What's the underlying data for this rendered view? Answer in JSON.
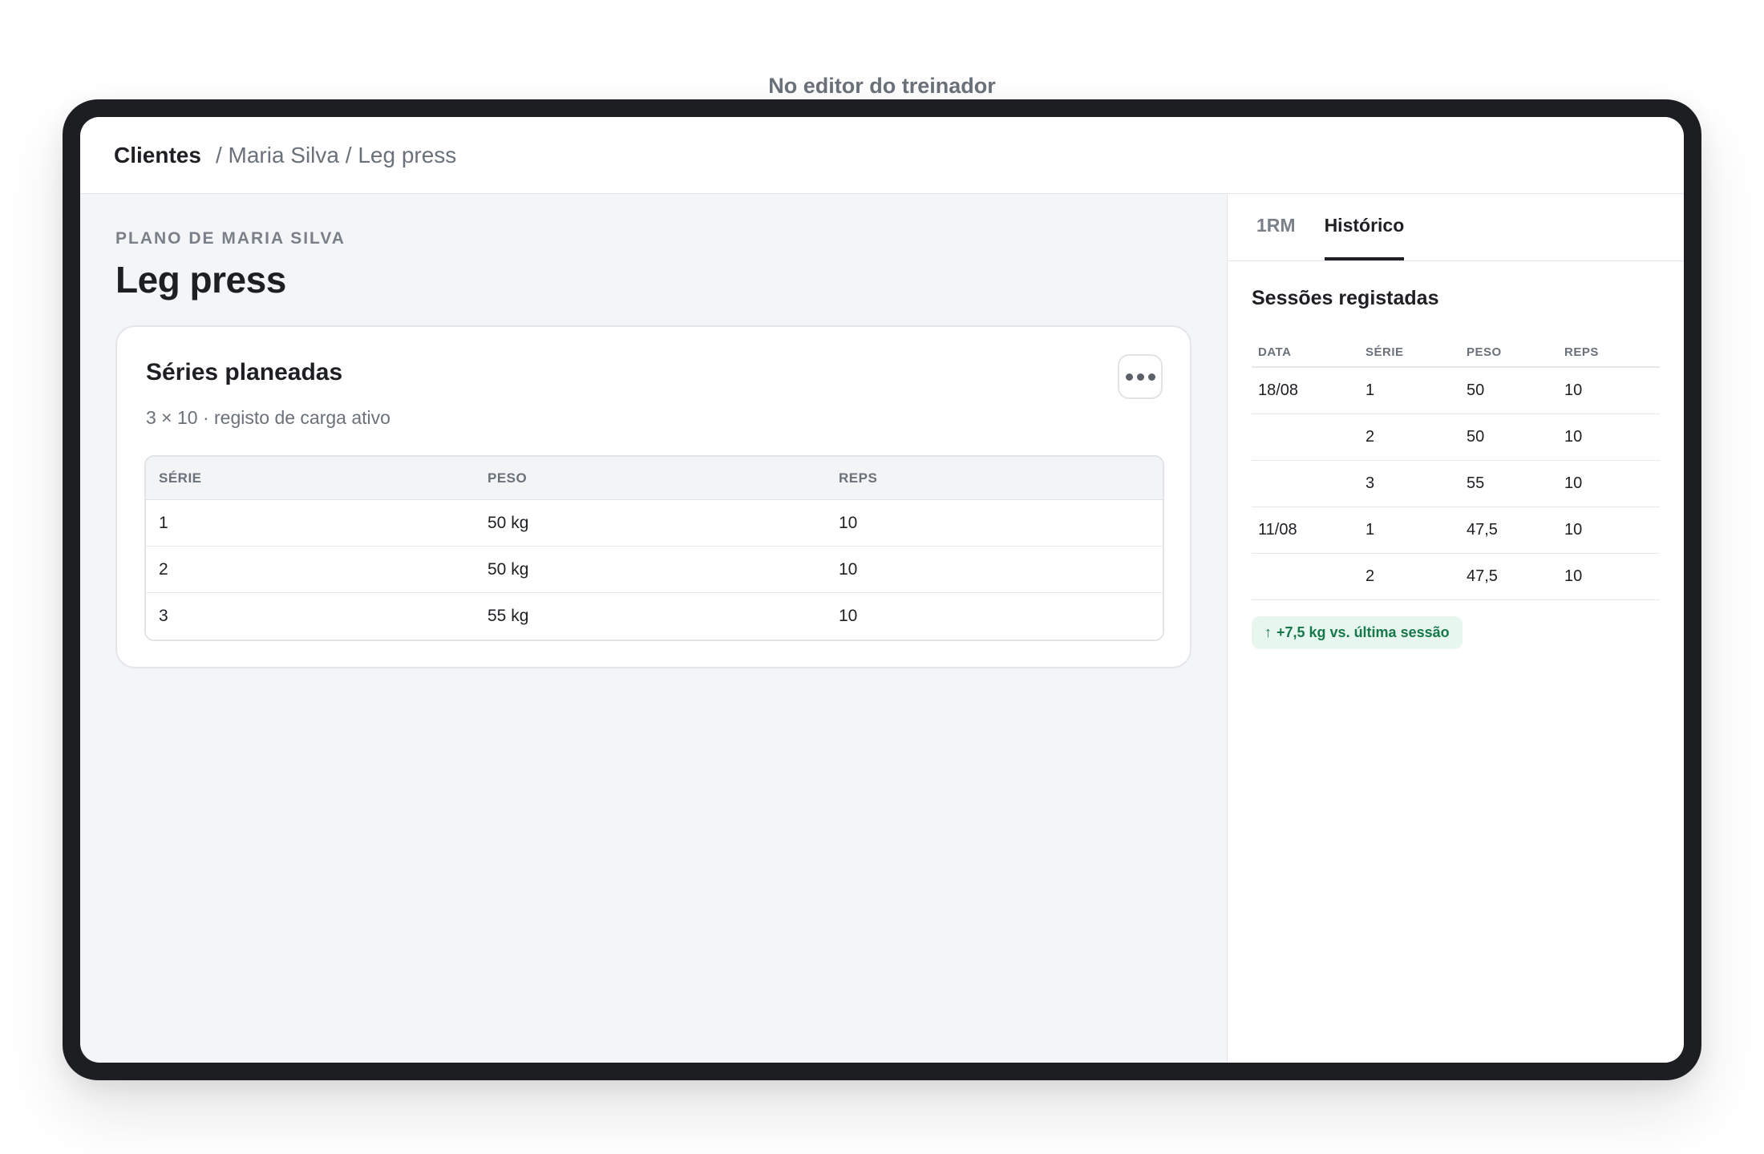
{
  "caption": "No editor do treinador",
  "breadcrumb": {
    "root": "Clientes",
    "rest": "/ Maria Silva / Leg press"
  },
  "main": {
    "overline": "PLANO DE MARIA SILVA",
    "title": "Leg press",
    "card": {
      "title": "Séries planeadas",
      "subtitle": "3 × 10 · registo de carga ativo",
      "more_icon": "more-horizontal-icon",
      "columns": [
        "SÉRIE",
        "PESO",
        "REPS"
      ],
      "rows": [
        {
          "serie": "1",
          "peso": "50 kg",
          "reps": "10"
        },
        {
          "serie": "2",
          "peso": "50 kg",
          "reps": "10"
        },
        {
          "serie": "3",
          "peso": "55 kg",
          "reps": "10"
        }
      ]
    }
  },
  "side": {
    "tabs": [
      {
        "label": "1RM",
        "active": false
      },
      {
        "label": "Histórico",
        "active": true
      }
    ],
    "title": "Sessões registadas",
    "columns": [
      "DATA",
      "SÉRIE",
      "PESO",
      "REPS"
    ],
    "rows": [
      {
        "data": "18/08",
        "serie": "1",
        "peso": "50",
        "reps": "10"
      },
      {
        "data": "",
        "serie": "2",
        "peso": "50",
        "reps": "10"
      },
      {
        "data": "",
        "serie": "3",
        "peso": "55",
        "reps": "10"
      },
      {
        "data": "11/08",
        "serie": "1",
        "peso": "47,5",
        "reps": "10"
      },
      {
        "data": "",
        "serie": "2",
        "peso": "47,5",
        "reps": "10"
      }
    ],
    "badge": {
      "icon": "arrow-up-icon",
      "arrow": "↑",
      "text": "+7,5 kg vs. última sessão",
      "color": "#17784a"
    }
  }
}
